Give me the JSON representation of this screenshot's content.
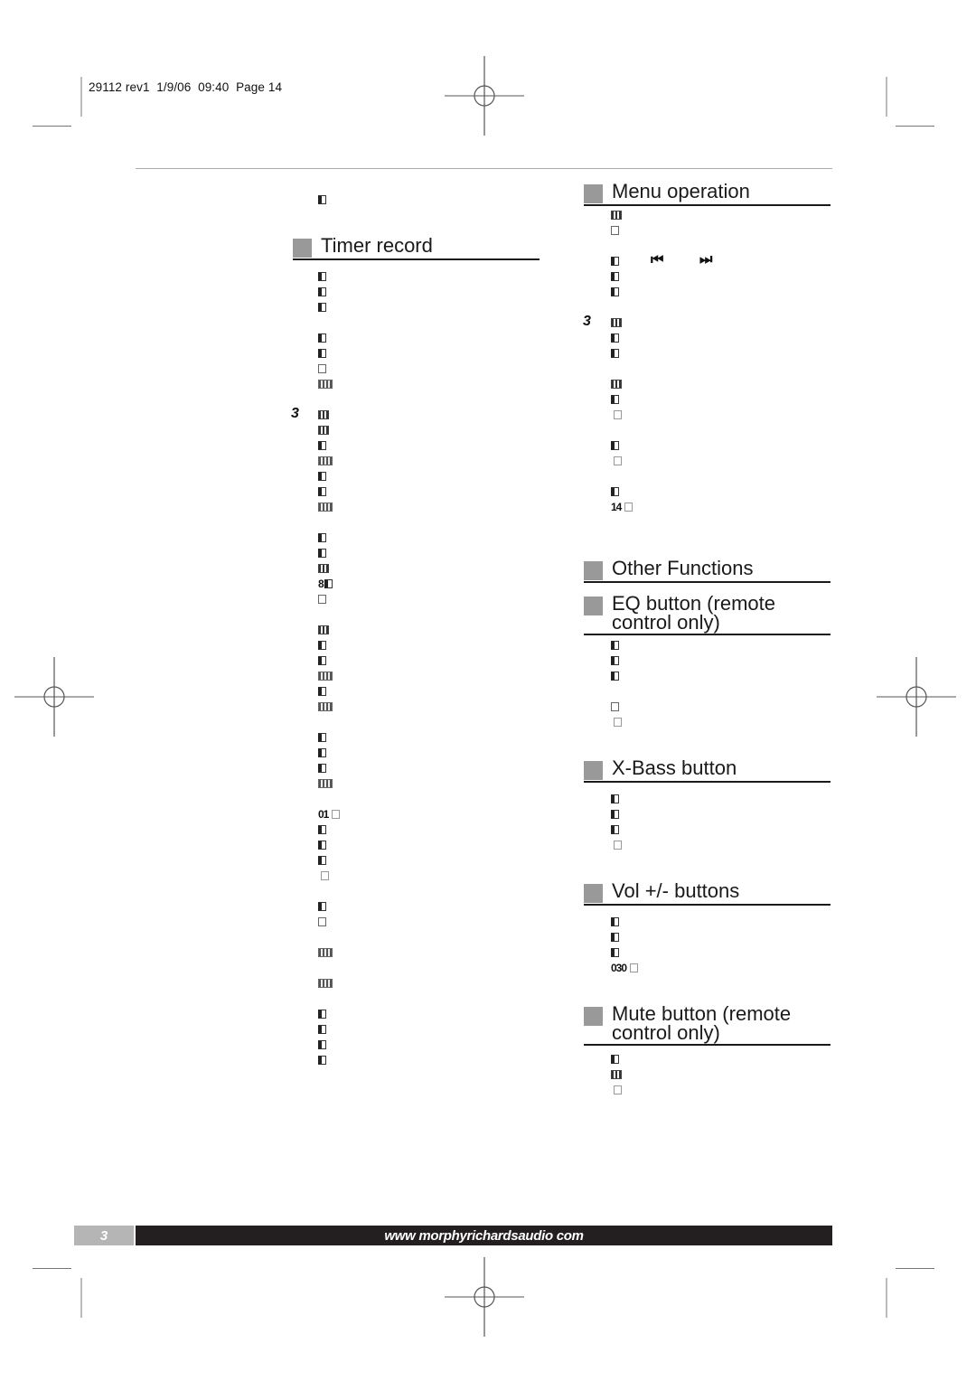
{
  "slug": "29112 rev1  1/9/06  09:40  Page 14",
  "left_column": {
    "pre_heading_glyphs": [
      "b1"
    ],
    "timer_record": {
      "heading": "Timer record",
      "lines": [
        {
          "glyphs": [
            "b1"
          ]
        },
        {
          "glyphs": [
            "b1"
          ]
        },
        {
          "glyphs": [
            "b1"
          ]
        },
        {
          "gap": true
        },
        {
          "glyphs": [
            "b1"
          ]
        },
        {
          "glyphs": [
            "b1"
          ]
        },
        {
          "glyphs": [
            "b4"
          ]
        },
        {
          "glyphs": [
            "b3"
          ]
        },
        {
          "gap": true
        },
        {
          "step": "3",
          "glyphs": [
            "b2"
          ]
        },
        {
          "glyphs": [
            "b2"
          ]
        },
        {
          "glyphs": [
            "b1"
          ]
        },
        {
          "glyphs": [
            "b3"
          ]
        },
        {
          "glyphs": [
            "b1"
          ]
        },
        {
          "glyphs": [
            "b1"
          ]
        },
        {
          "glyphs": [
            "b3"
          ]
        },
        {
          "gap": true
        },
        {
          "glyphs": [
            "b1"
          ]
        },
        {
          "glyphs": [
            "b1"
          ]
        },
        {
          "glyphs": [
            "b2"
          ]
        },
        {
          "num": "8",
          "glyphs": [
            "b1"
          ]
        },
        {
          "glyphs": [
            "b4"
          ]
        },
        {
          "gap": true
        },
        {
          "glyphs": [
            "b2"
          ]
        },
        {
          "glyphs": [
            "b1"
          ]
        },
        {
          "glyphs": [
            "b1"
          ]
        },
        {
          "glyphs": [
            "b3"
          ]
        },
        {
          "glyphs": [
            "b1"
          ]
        },
        {
          "glyphs": [
            "b3"
          ]
        },
        {
          "gap": true
        },
        {
          "glyphs": [
            "b1"
          ]
        },
        {
          "glyphs": [
            "b1"
          ]
        },
        {
          "glyphs": [
            "b1"
          ]
        },
        {
          "glyphs": [
            "b3"
          ]
        },
        {
          "gap": true
        },
        {
          "num": "01",
          "glyphs": [
            "lt"
          ]
        },
        {
          "glyphs": [
            "b1"
          ]
        },
        {
          "glyphs": [
            "b1"
          ]
        },
        {
          "glyphs": [
            "b1"
          ]
        },
        {
          "glyphs": [
            "lt"
          ]
        },
        {
          "gap": true
        },
        {
          "glyphs": [
            "b1"
          ]
        },
        {
          "glyphs": [
            "b4"
          ]
        },
        {
          "gap": true
        },
        {
          "glyphs": [
            "b3"
          ]
        },
        {
          "gap": true
        },
        {
          "glyphs": [
            "b3"
          ]
        },
        {
          "gap": true
        },
        {
          "glyphs": [
            "b1"
          ]
        },
        {
          "glyphs": [
            "b1"
          ]
        },
        {
          "glyphs": [
            "b1"
          ]
        },
        {
          "glyphs": [
            "b1"
          ]
        }
      ]
    }
  },
  "right_column": {
    "sections": [
      {
        "id": "menu-operation",
        "heading": "Menu operation",
        "lines": [
          {
            "glyphs": [
              "b2"
            ]
          },
          {
            "glyphs": [
              "b4"
            ]
          },
          {
            "gap": true
          },
          {
            "glyphs": [
              "b1"
            ],
            "transport": true
          },
          {
            "glyphs": [
              "b1"
            ]
          },
          {
            "glyphs": [
              "b1"
            ]
          },
          {
            "gap": true
          },
          {
            "step": "3",
            "glyphs": [
              "b2"
            ]
          },
          {
            "glyphs": [
              "b1"
            ]
          },
          {
            "glyphs": [
              "b1"
            ]
          },
          {
            "gap": true
          },
          {
            "glyphs": [
              "b2"
            ]
          },
          {
            "glyphs": [
              "b1"
            ]
          },
          {
            "glyphs": [
              "lt"
            ]
          },
          {
            "gap": true
          },
          {
            "glyphs": [
              "b1"
            ]
          },
          {
            "glyphs": [
              "lt"
            ]
          },
          {
            "gap": true
          },
          {
            "glyphs": [
              "b1"
            ]
          },
          {
            "num": "14",
            "glyphs": [
              "lt"
            ]
          }
        ]
      },
      {
        "id": "other-functions",
        "heading": "Other Functions",
        "lines": []
      },
      {
        "id": "eq-button",
        "heading": "EQ button (remote control only)",
        "lines": [
          {
            "glyphs": [
              "b1"
            ]
          },
          {
            "glyphs": [
              "b1"
            ]
          },
          {
            "glyphs": [
              "b1"
            ]
          },
          {
            "gap": true
          },
          {
            "glyphs": [
              "b4"
            ]
          },
          {
            "glyphs": [
              "lt"
            ]
          }
        ]
      },
      {
        "id": "x-bass-button",
        "heading": "X-Bass button",
        "lines": [
          {
            "glyphs": [
              "b1"
            ]
          },
          {
            "glyphs": [
              "b1"
            ]
          },
          {
            "glyphs": [
              "b1"
            ]
          },
          {
            "glyphs": [
              "lt"
            ]
          }
        ]
      },
      {
        "id": "vol-buttons",
        "heading": "Vol +/- buttons",
        "lines": [
          {
            "glyphs": [
              "b1"
            ]
          },
          {
            "glyphs": [
              "b1"
            ]
          },
          {
            "glyphs": [
              "b1"
            ]
          },
          {
            "num": "030",
            "glyphs": [
              "lt"
            ]
          }
        ]
      },
      {
        "id": "mute-button",
        "heading": "Mute button (remote control only)",
        "lines": [
          {
            "glyphs": [
              "b1"
            ]
          },
          {
            "glyphs": [
              "b2"
            ]
          },
          {
            "glyphs": [
              "lt"
            ]
          }
        ]
      }
    ]
  },
  "transport_icons": [
    "previous-track-icon",
    "next-track-icon"
  ],
  "transport_glyphs": {
    "prev": "⏮",
    "next": "⏭"
  },
  "footer": {
    "page_number": "3",
    "website": "www morphyrichardsaudio com"
  },
  "colors": {
    "heading_square": "#999999",
    "footer_bar": "#231f20",
    "footer_page_tab": "#b5b5b5"
  }
}
